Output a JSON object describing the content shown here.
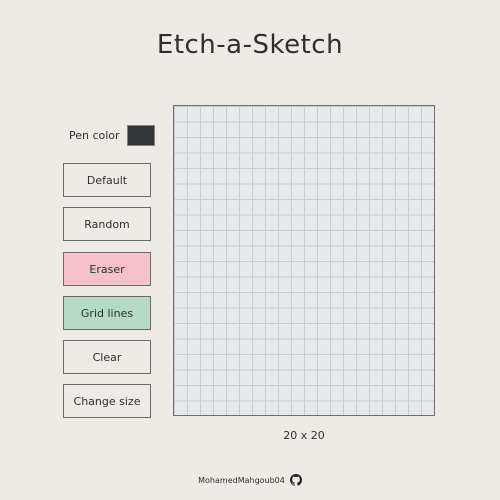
{
  "title": "Etch-a-Sketch",
  "pen": {
    "label": "Pen color",
    "color": "#333438"
  },
  "buttons": [
    {
      "label": "Default",
      "bg": "transparent"
    },
    {
      "label": "Random",
      "bg": "transparent"
    },
    {
      "label": "Eraser",
      "bg": "#f5c2cb"
    },
    {
      "label": "Grid lines",
      "bg": "#b5dbc7"
    },
    {
      "label": "Clear",
      "bg": "transparent"
    },
    {
      "label": "Change size",
      "bg": "transparent"
    }
  ],
  "grid": {
    "cols": 20,
    "rows": 20,
    "background": "#e7e9eb",
    "line_color": "#c8cbd0"
  },
  "size_label": "20 x 20",
  "footer": {
    "author": "MohamedMahgoub04",
    "icon": "github-icon"
  }
}
